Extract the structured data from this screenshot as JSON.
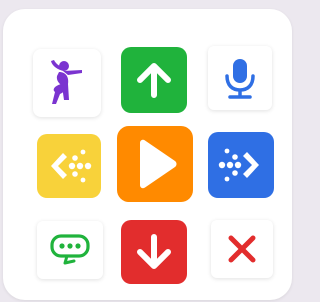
{
  "palette": {
    "accent_colors": {
      "green": "#20b33c",
      "orange": "#ff8a00",
      "blue": "#2f6fe4",
      "yellow": "#f8d23a",
      "red": "#e22d2d",
      "purple": "#7b34d0"
    }
  },
  "tiles": [
    {
      "name": "dance-tile",
      "icon": "dancer-icon"
    },
    {
      "name": "move-up-tile",
      "icon": "arrow-up-icon"
    },
    {
      "name": "microphone-tile",
      "icon": "microphone-icon"
    },
    {
      "name": "move-left-tile",
      "icon": "dotted-arrow-left-icon"
    },
    {
      "name": "play-tile",
      "icon": "play-icon"
    },
    {
      "name": "move-right-tile",
      "icon": "dotted-arrow-right-icon"
    },
    {
      "name": "speech-loop-tile",
      "icon": "speech-bubble-loop-icon"
    },
    {
      "name": "move-down-tile",
      "icon": "arrow-down-icon"
    },
    {
      "name": "delete-tile",
      "icon": "close-icon"
    }
  ]
}
